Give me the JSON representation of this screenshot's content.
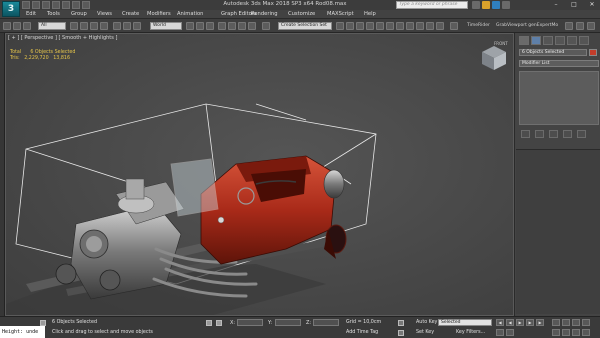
{
  "window": {
    "title": "Autodesk 3ds Max  2018 SP3 x64     Rod08.max",
    "search_placeholder": "Type a keyword or phrase",
    "logo_text": "3"
  },
  "menus": [
    "Edit",
    "Tools",
    "Group",
    "Views",
    "Create",
    "Modifiers",
    "Animation",
    "Graph Editors",
    "Rendering",
    "Customize",
    "MAXScript",
    "Help"
  ],
  "toolbar": {
    "filter_value": "All",
    "ref_coord_value": "World",
    "named_sel_value": "Create Selection Set",
    "timerider_label": "TimeRider",
    "grabviewport_label": "GrabViewport genExpertMo"
  },
  "viewport": {
    "label": "[ + ] [ Perspective ] [ Smooth + Highlights ]",
    "stats_total_label": "Total",
    "stats_total_value": "6 Objects Selected",
    "stats_tris_label": "Tris:",
    "stats_tris_value": "2,229,720",
    "stats_tris_sel": "13,816",
    "viewcube_label": "FRONT"
  },
  "command_panel": {
    "object_name": "6 Objects Selected",
    "modifier_list": "Modifier List"
  },
  "status": {
    "maxscript_text": "Height: unde",
    "selection_count": "6 Objects Selected",
    "prompt": "Click and drag to select and move objects",
    "x_label": "X:",
    "y_label": "Y:",
    "z_label": "Z:",
    "grid": "Grid = 10,0cm",
    "add_time_tag": "Add Time Tag",
    "auto_key": "Auto Key",
    "set_key": "Set Key",
    "selected_value": "Selected",
    "key_filters": "Key Filters..."
  },
  "colors": {
    "car_body": "#b5321f",
    "stats_text": "#e7c64a",
    "viewport_bg": "#474747"
  },
  "icons": [
    "app-logo-icon",
    "search-icon",
    "minimize-icon",
    "maximize-icon",
    "close-icon",
    "select-icon",
    "move-icon",
    "rotate-icon",
    "scale-icon",
    "undo-icon",
    "redo-icon",
    "play-icon",
    "lock-icon"
  ]
}
